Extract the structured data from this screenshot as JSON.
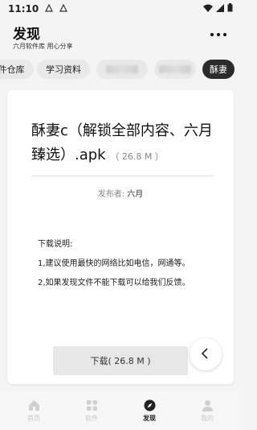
{
  "status": {
    "time": "11:10"
  },
  "header": {
    "title": "发现",
    "subtitle": "六月软件库 用心分享"
  },
  "tabs": [
    {
      "label": "件仓库"
    },
    {
      "label": "学习资料"
    },
    {
      "label": ""
    },
    {
      "label": ""
    },
    {
      "label": "酥妻"
    }
  ],
  "file": {
    "name": "酥妻c（解锁全部内容、六月臻选）.apk",
    "size": "（ 26.8 M ）",
    "publisher_label": "发布者: ",
    "publisher_name": "六月"
  },
  "description": {
    "heading": "下载说明:",
    "line1": "1,建议使用最快的网络比如电信，网通等。",
    "line2": "2,如果发现文件不能下载可以给我们反馈。"
  },
  "download": {
    "label": "下载( 26.8 M )"
  },
  "nav": [
    {
      "label": "首页"
    },
    {
      "label": "软件"
    },
    {
      "label": "发现"
    },
    {
      "label": "我的"
    }
  ],
  "colors": {
    "active_tab_bg": "#2b2b2b",
    "nav_inactive": "#c9c9c9",
    "button_bg": "#e7e7e7"
  },
  "icons": {
    "nav_home": "home-icon",
    "nav_apps": "grid-icon",
    "nav_discover": "compass-icon",
    "nav_profile": "person-icon",
    "back": "chevron-left-icon"
  }
}
